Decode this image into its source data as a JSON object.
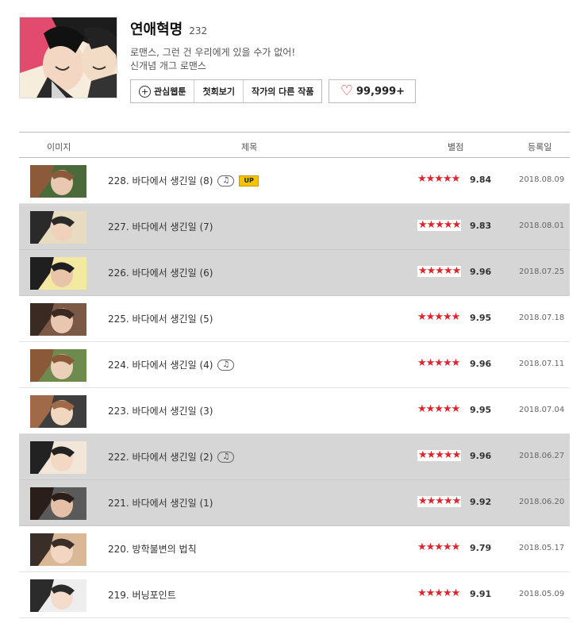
{
  "webtoon": {
    "title": "연애혁명",
    "count": "232",
    "desc_line1": "로맨스, 그런 건 우리에게 있을 수가 없어!",
    "desc_line2": "신개념 개그 로맨스",
    "buttons": {
      "interest": "관심웹툰",
      "first": "첫회보기",
      "other": "작가의 다른 작품"
    },
    "likes": "99,999+"
  },
  "table": {
    "headers": {
      "image": "이미지",
      "title": "제목",
      "rating": "별점",
      "date": "등록일"
    },
    "rows": [
      {
        "title": "228. 바다에서 생긴일 (8)",
        "music": true,
        "up": "UP",
        "stars": "★★★★★",
        "score": "9.84",
        "date": "2018.08.09",
        "gray": false
      },
      {
        "title": "227. 바다에서 생긴일 (7)",
        "music": false,
        "up": "",
        "stars": "★★★★★",
        "score": "9.83",
        "date": "2018.08.01",
        "gray": true
      },
      {
        "title": "226. 바다에서 생긴일 (6)",
        "music": false,
        "up": "",
        "stars": "★★★★★",
        "score": "9.96",
        "date": "2018.07.25",
        "gray": true
      },
      {
        "title": "225. 바다에서 생긴일 (5)",
        "music": false,
        "up": "",
        "stars": "★★★★★",
        "score": "9.95",
        "date": "2018.07.18",
        "gray": false
      },
      {
        "title": "224. 바다에서 생긴일 (4)",
        "music": true,
        "up": "",
        "stars": "★★★★★",
        "score": "9.96",
        "date": "2018.07.11",
        "gray": false
      },
      {
        "title": "223. 바다에서 생긴일 (3)",
        "music": false,
        "up": "",
        "stars": "★★★★★",
        "score": "9.95",
        "date": "2018.07.04",
        "gray": false
      },
      {
        "title": "222. 바다에서 생긴일 (2)",
        "music": true,
        "up": "",
        "stars": "★★★★★",
        "score": "9.96",
        "date": "2018.06.27",
        "gray": true
      },
      {
        "title": "221. 바다에서 생긴일 (1)",
        "music": false,
        "up": "",
        "stars": "★★★★★",
        "score": "9.92",
        "date": "2018.06.20",
        "gray": true
      },
      {
        "title": "220. 방학불변의 법칙",
        "music": false,
        "up": "",
        "stars": "★★★★★",
        "score": "9.79",
        "date": "2018.05.17",
        "gray": false
      },
      {
        "title": "219. 버닝포인트",
        "music": false,
        "up": "",
        "stars": "★★★★★",
        "score": "9.91",
        "date": "2018.05.09",
        "gray": false
      }
    ]
  },
  "colors": {
    "star": "#e0242b",
    "up_badge": "#f5c400",
    "row_gray": "#d6d6d6",
    "heart": "#e0242b"
  },
  "icons": {
    "interest": "plus-circle-icon",
    "music": "music-note-icon",
    "like": "heart-icon"
  }
}
